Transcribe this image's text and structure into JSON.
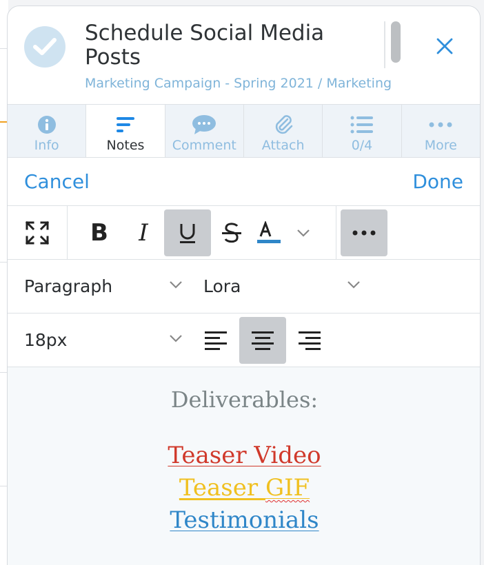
{
  "task": {
    "title": "Schedule Social Media Posts",
    "breadcrumb": "Marketing Campaign - Spring 2021 / Marketing"
  },
  "tabs": [
    {
      "label": "Info",
      "icon": "info-icon",
      "active": false
    },
    {
      "label": "Notes",
      "icon": "notes-icon",
      "active": true
    },
    {
      "label": "Comment",
      "icon": "comment-icon",
      "active": false
    },
    {
      "label": "Attach",
      "icon": "paperclip-icon",
      "active": false
    },
    {
      "label": "0/4",
      "icon": "checklist-icon",
      "active": false
    },
    {
      "label": "More",
      "icon": "more-icon",
      "active": false
    }
  ],
  "actions": {
    "cancel": "Cancel",
    "done": "Done"
  },
  "toolbar": {
    "bold": "B",
    "italic": "I",
    "text_color": "#2f86c8"
  },
  "format": {
    "block": "Paragraph",
    "font": "Lora",
    "size": "18px",
    "alignment": "center"
  },
  "content": {
    "heading": "Deliverables:",
    "items": [
      {
        "text": "Teaser Video",
        "color": "#d0392b"
      },
      {
        "text": "Teaser GIF",
        "color": "#f0c020"
      },
      {
        "text": "Testimonials",
        "color": "#2f86c8"
      }
    ]
  },
  "colors": {
    "accent": "#2f8fdc",
    "breadcrumb": "#7fb4d9",
    "tab_inactive": "#8fbde0"
  }
}
